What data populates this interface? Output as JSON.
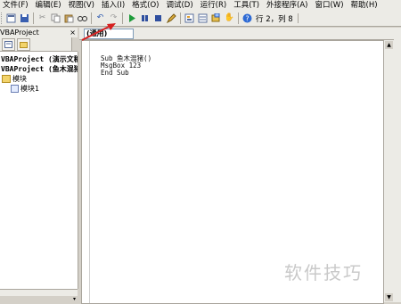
{
  "menubar": {
    "items": [
      "文件(F)",
      "编辑(E)",
      "视图(V)",
      "插入(I)",
      "格式(O)",
      "调试(D)",
      "运行(R)",
      "工具(T)",
      "外接程序(A)",
      "窗口(W)",
      "帮助(H)"
    ]
  },
  "toolbar": {
    "status": "行 2，列 8",
    "icons": [
      "view-icon",
      "save-icon",
      "cut-icon",
      "copy-icon",
      "paste-icon",
      "find-icon",
      "undo-icon",
      "redo-icon",
      "run-icon",
      "break-icon",
      "reset-icon",
      "design-mode-icon",
      "project-explorer-icon",
      "properties-icon",
      "object-browser-icon",
      "toolbox-icon",
      "help-icon"
    ]
  },
  "project_panel": {
    "title": "VBAProject",
    "close_glyph": "×",
    "tree": [
      {
        "label": "VBAProject (演示文稿",
        "level": 0
      },
      {
        "label": "VBAProject (鱼木混猪",
        "level": 0
      },
      {
        "label": "模块",
        "level": 1
      },
      {
        "label": "模块1",
        "level": 2
      }
    ]
  },
  "code_window": {
    "object_combo": "(通用)",
    "lines": [
      "Sub 鱼木混猪()",
      "MsgBox 123",
      "End Sub"
    ]
  },
  "watermark": "软件技巧",
  "accent_colors": {
    "run": "#1e9b3a",
    "annotation_arrow": "#d62020",
    "help": "#2f6bd4"
  }
}
